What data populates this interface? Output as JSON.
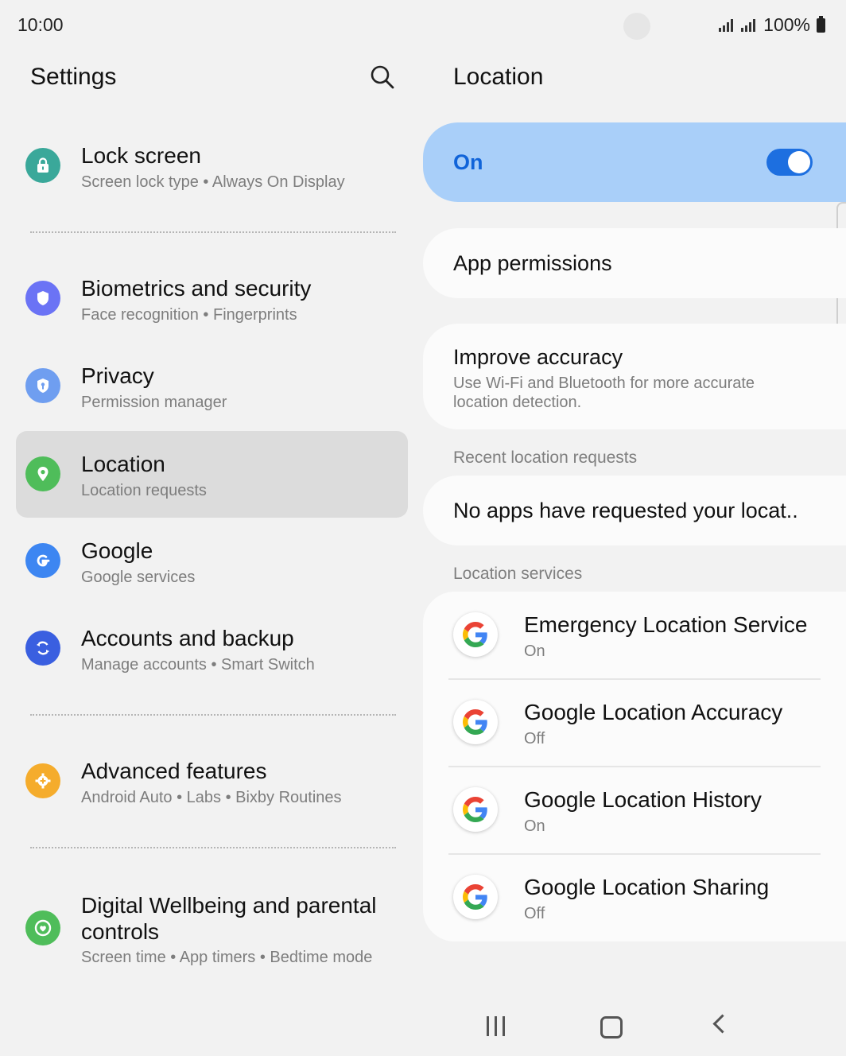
{
  "status_bar": {
    "time": "10:00",
    "battery": "100%"
  },
  "left": {
    "title": "Settings",
    "items": [
      {
        "title": "Lock screen",
        "subtitle": "Screen lock type  •  Always On Display",
        "icon": "lock-icon",
        "color": "#3aa89a"
      },
      {
        "title": "Biometrics and security",
        "subtitle": "Face recognition  •  Fingerprints",
        "icon": "shield-icon",
        "color": "#6b73f5"
      },
      {
        "title": "Privacy",
        "subtitle": "Permission manager",
        "icon": "privacy-shield-icon",
        "color": "#6f9ef0"
      },
      {
        "title": "Location",
        "subtitle": "Location requests",
        "icon": "location-pin-icon",
        "color": "#4fbd5a"
      },
      {
        "title": "Google",
        "subtitle": "Google services",
        "icon": "google-g-icon",
        "color": "#3d86f2"
      },
      {
        "title": "Accounts and backup",
        "subtitle": "Manage accounts  •  Smart Switch",
        "icon": "sync-icon",
        "color": "#3a5fe0"
      },
      {
        "title": "Advanced features",
        "subtitle": "Android Auto  •  Labs  •  Bixby Routines",
        "icon": "gear-plus-icon",
        "color": "#f5ac2c"
      },
      {
        "title": "Digital Wellbeing and parental controls",
        "title_line1": "Digital Wellbeing and parental",
        "title_line2": "controls",
        "subtitle": "Screen time  •  App timers  •  Bedtime mode",
        "icon": "wellbeing-icon",
        "color": "#4fbd5a"
      }
    ]
  },
  "right": {
    "title": "Location",
    "toggle": {
      "label": "On",
      "state": "on"
    },
    "app_permissions": "App permissions",
    "improve_accuracy": {
      "title": "Improve accuracy",
      "subtitle": "Use Wi-Fi and Bluetooth for more accurate location detection."
    },
    "recent_header": "Recent location requests",
    "recent_text": "No apps have requested your locat..",
    "services_header": "Location services",
    "services": [
      {
        "title": "Emergency Location Service",
        "status": "On"
      },
      {
        "title": "Google Location Accuracy",
        "status": "Off"
      },
      {
        "title": "Google Location History",
        "status": "On"
      },
      {
        "title": "Google Location Sharing",
        "status": "Off"
      }
    ]
  },
  "nav_bar": {
    "recent": "recent-apps-icon",
    "home": "home-icon",
    "back": "back-icon"
  }
}
